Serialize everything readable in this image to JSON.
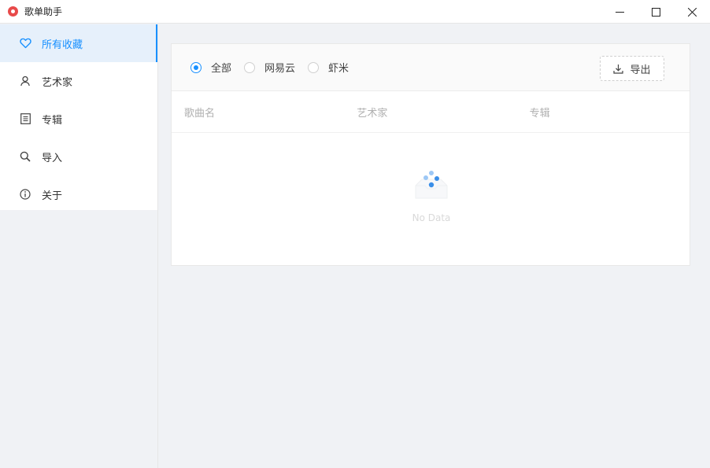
{
  "window": {
    "title": "歌单助手",
    "controls": [
      "minimize",
      "maximize",
      "close"
    ]
  },
  "sidebar": {
    "items": [
      {
        "label": "所有收藏",
        "icon": "heart-icon",
        "active": true
      },
      {
        "label": "艺术家",
        "icon": "user-icon",
        "active": false
      },
      {
        "label": "专辑",
        "icon": "album-icon",
        "active": false
      },
      {
        "label": "导入",
        "icon": "search-icon",
        "active": false
      },
      {
        "label": "关于",
        "icon": "info-icon",
        "active": false
      }
    ]
  },
  "filter": {
    "options": [
      {
        "label": "全部",
        "checked": true
      },
      {
        "label": "网易云",
        "checked": false
      },
      {
        "label": "虾米",
        "checked": false
      }
    ],
    "export_label": "导出"
  },
  "table": {
    "columns": [
      "歌曲名",
      "艺术家",
      "专辑"
    ],
    "empty_text": "No Data"
  },
  "colors": {
    "accent": "#1890ff",
    "active_bg": "#e6f0fb",
    "page_bg": "#f0f2f5"
  }
}
